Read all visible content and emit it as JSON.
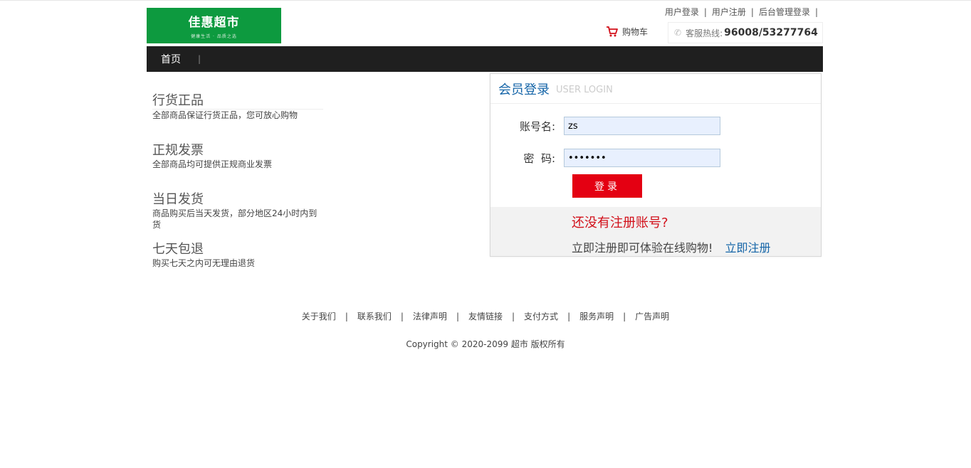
{
  "header": {
    "logo_text": "佳惠超市",
    "logo_tagline": "健康生活 · 品质之选",
    "top_links": [
      "用户登录",
      "用户注册",
      "后台管理登录"
    ],
    "cart_label": "购物车",
    "hotline_label": "客服热线:",
    "hotline_number": "96008/53277764"
  },
  "nav": {
    "items": [
      "首页"
    ]
  },
  "features": [
    {
      "title": "行货正品",
      "desc": "全部商品保证行货正品，您可放心购物"
    },
    {
      "title": "正规发票",
      "desc": "全部商品均可提供正规商业发票"
    },
    {
      "title": "当日发货",
      "desc": "商品购买后当天发货，部分地区24小时内到货"
    },
    {
      "title": "七天包退",
      "desc": "购买七天之内可无理由退货"
    }
  ],
  "login": {
    "title": "会员登录",
    "title_en": "USER LOGIN",
    "username_label": "账号名:",
    "username_value": "zs",
    "password_label": "密  码:",
    "password_value": "1234567",
    "submit_label": "登录",
    "no_account_text": "还没有注册账号?",
    "register_tip": "立即注册即可体验在线购物!",
    "register_link": "立即注册"
  },
  "footer": {
    "links": [
      "关于我们",
      "联系我们",
      "法律声明",
      "友情链接",
      "支付方式",
      "服务声明",
      "广告声明"
    ],
    "copyright": "Copyright © 2020-2099 超市 版权所有"
  },
  "colors": {
    "brand_green": "#0d9a3f",
    "nav_bg": "#1f1f1f",
    "accent_red": "#e40012",
    "link_blue": "#1565a8"
  }
}
